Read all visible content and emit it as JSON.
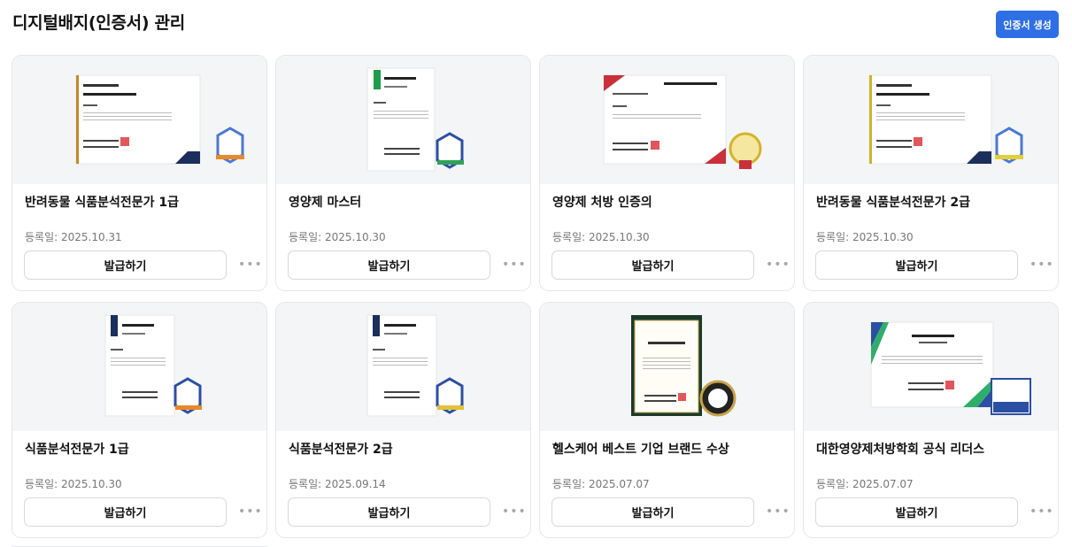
{
  "header": {
    "title": "디지털배지(인증서) 관리",
    "create_label": "인증서 생성"
  },
  "cards": [
    {
      "title": "반려동물 식품분석전문가 1급",
      "date": "등록일: 2025.10.31",
      "issue_label": "발급하기",
      "more_icon": "more-horizontal-icon"
    },
    {
      "title": "영양제 마스터",
      "date": "등록일: 2025.10.30",
      "issue_label": "발급하기",
      "more_icon": "more-horizontal-icon"
    },
    {
      "title": "영양제 처방 인증의",
      "date": "등록일: 2025.10.30",
      "issue_label": "발급하기",
      "more_icon": "more-horizontal-icon"
    },
    {
      "title": "반려동물 식품분석전문가 2급",
      "date": "등록일: 2025.10.30",
      "issue_label": "발급하기",
      "more_icon": "more-horizontal-icon"
    },
    {
      "title": "식품분석전문가 1급",
      "date": "등록일: 2025.10.30",
      "issue_label": "발급하기",
      "more_icon": "more-horizontal-icon"
    },
    {
      "title": "식품분석전문가 2급",
      "date": "등록일: 2025.09.14",
      "issue_label": "발급하기",
      "more_icon": "more-horizontal-icon"
    },
    {
      "title": "헬스케어 베스트 기업 브랜드 수상",
      "date": "등록일: 2025.07.07",
      "issue_label": "발급하기",
      "more_icon": "more-horizontal-icon"
    },
    {
      "title": "대한영양제처방학회 공식 리더스",
      "date": "등록일: 2025.07.07",
      "issue_label": "발급하기",
      "more_icon": "more-horizontal-icon"
    }
  ],
  "colors": {
    "accent": "#2f6fe6",
    "badge_blue": "#2b4fa3",
    "badge_gold": "#d4b42a",
    "cert_green": "#1e9b4b",
    "cert_navy": "#1c2e5c",
    "cert_red": "#c9303a"
  }
}
